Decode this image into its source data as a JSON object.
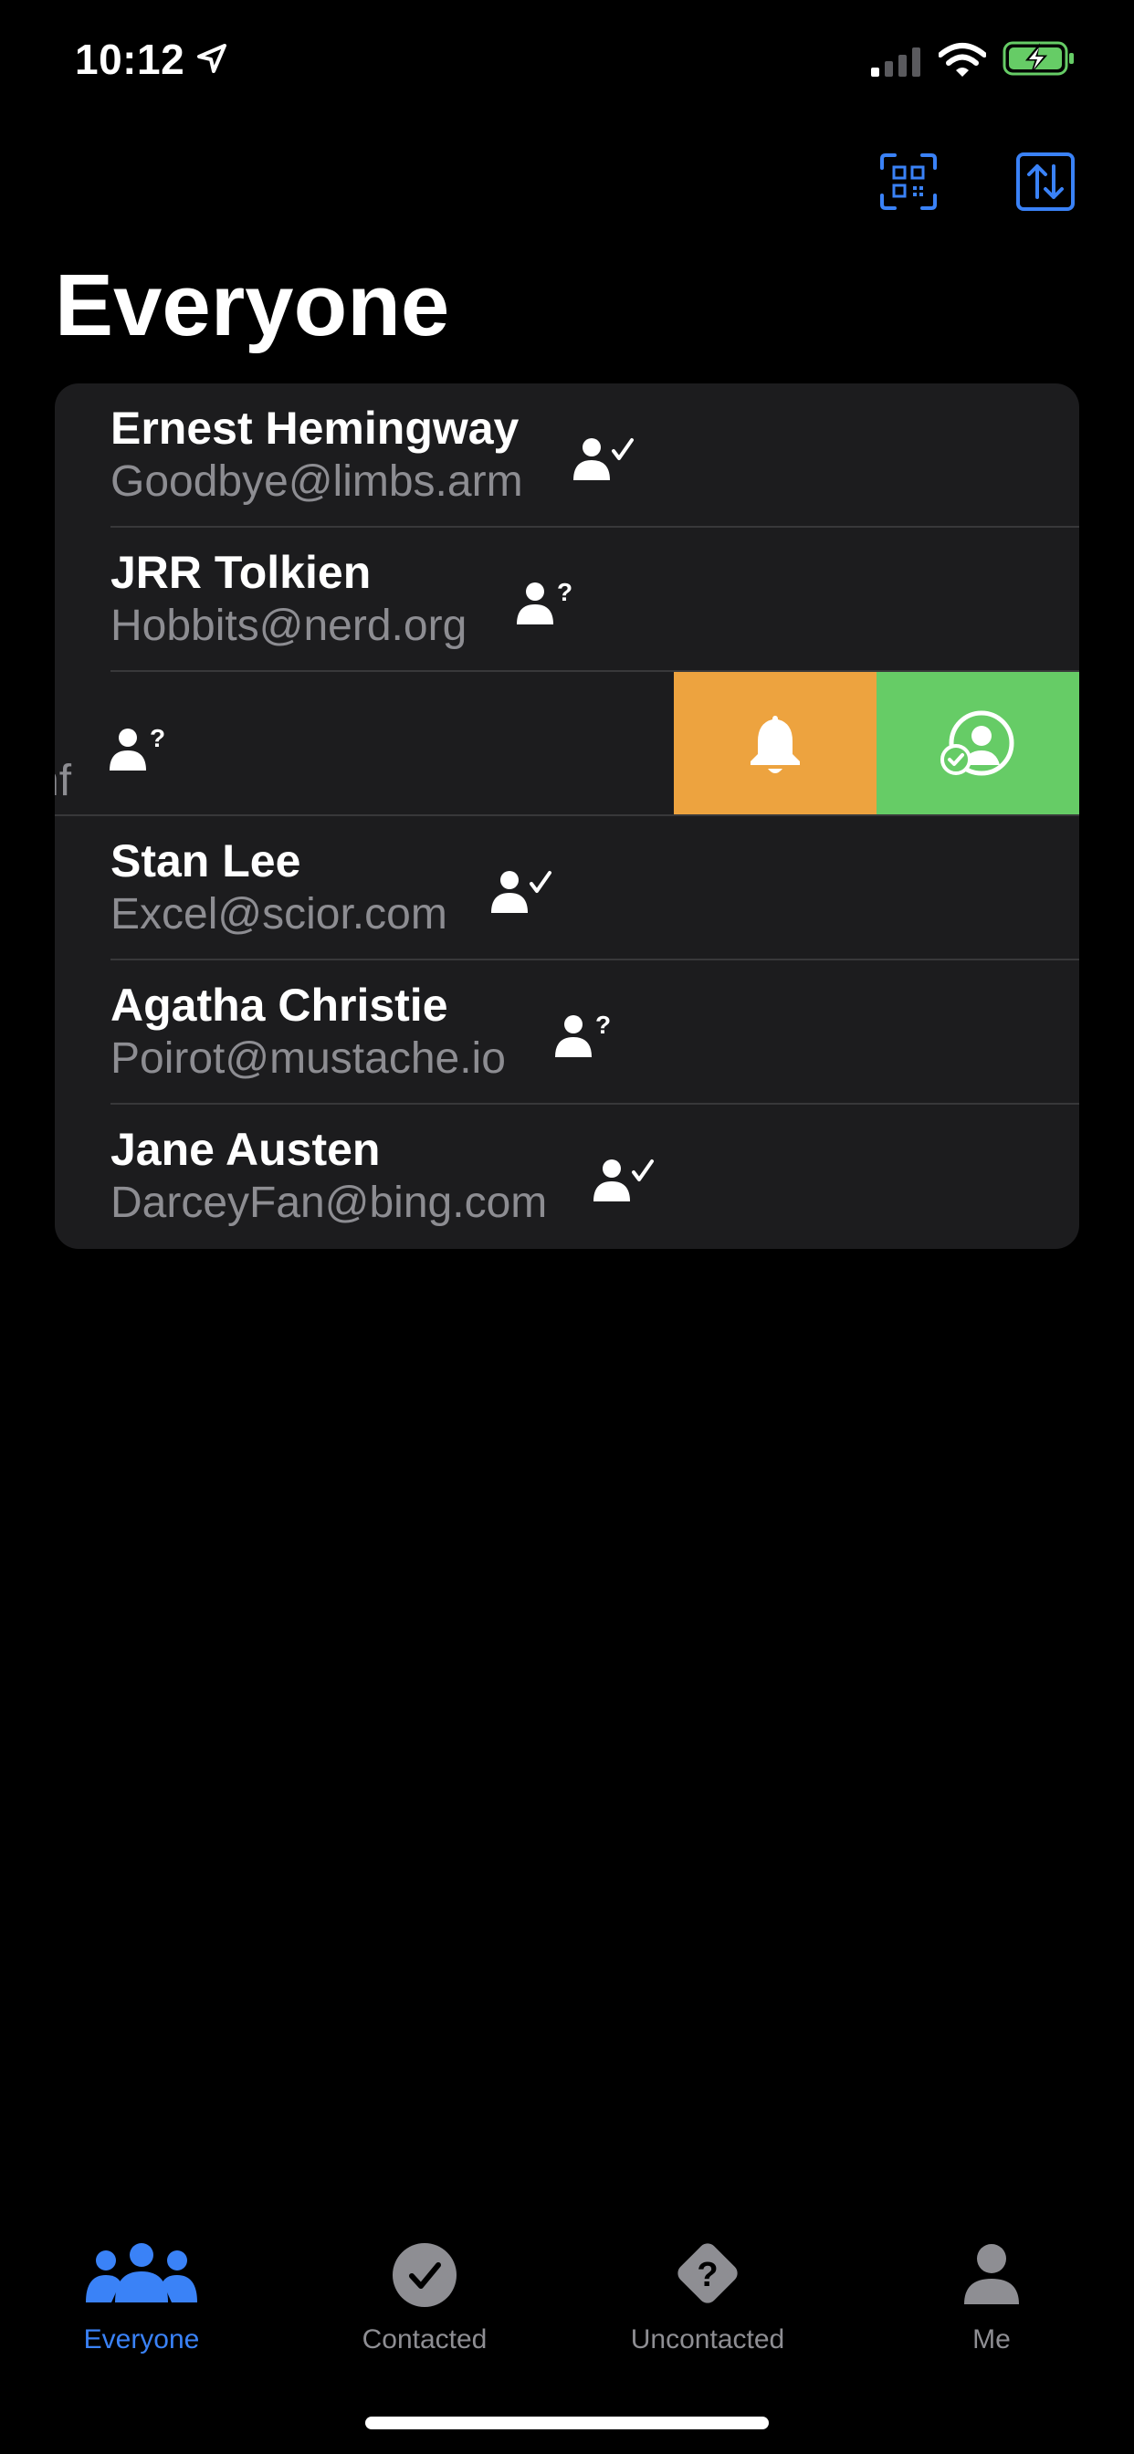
{
  "status_bar": {
    "time": "10:12"
  },
  "header": {
    "title": "Everyone"
  },
  "contacts": [
    {
      "name": "Ernest Hemingway",
      "email": "Goodbye@limbs.arm",
      "status": "contacted"
    },
    {
      "name": "JRR Tolkien",
      "email": "Hobbits@nerd.org",
      "status": "uncontacted"
    },
    {
      "name": "",
      "email": "nf",
      "status": "uncontacted",
      "swiped": true
    },
    {
      "name": "Stan Lee",
      "email": "Excel@scior.com",
      "status": "contacted"
    },
    {
      "name": "Agatha Christie",
      "email": "Poirot@mustache.io",
      "status": "uncontacted"
    },
    {
      "name": "Jane Austen",
      "email": "DarceyFan@bing.com",
      "status": "contacted"
    }
  ],
  "swipe_actions": [
    {
      "icon": "bell-icon",
      "color": "#eda33f"
    },
    {
      "icon": "person-check-icon",
      "color": "#66cc66"
    }
  ],
  "tabs": [
    {
      "label": "Everyone",
      "icon": "people-icon",
      "active": true
    },
    {
      "label": "Contacted",
      "icon": "checkmark-circle-icon",
      "active": false
    },
    {
      "label": "Uncontacted",
      "icon": "question-diamond-icon",
      "active": false
    },
    {
      "label": "Me",
      "icon": "person-icon",
      "active": false
    }
  ],
  "colors": {
    "accent": "#3a82f7",
    "background": "#000000",
    "card": "#1c1c1e",
    "notify": "#eda33f",
    "contacted": "#66cc66"
  }
}
